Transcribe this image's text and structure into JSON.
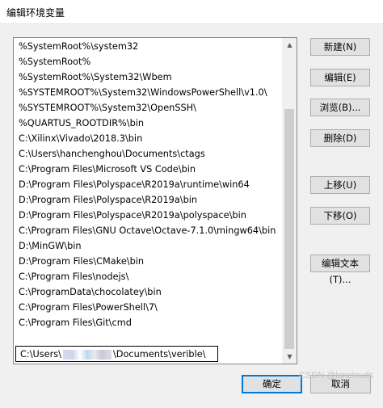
{
  "window": {
    "title": "编辑环境变量"
  },
  "list": {
    "items": [
      "%SystemRoot%\\system32",
      "%SystemRoot%",
      "%SystemRoot%\\System32\\Wbem",
      "%SYSTEMROOT%\\System32\\WindowsPowerShell\\v1.0\\",
      "%SYSTEMROOT%\\System32\\OpenSSH\\",
      "%QUARTUS_ROOTDIR%\\bin",
      "C:\\Xilinx\\Vivado\\2018.3\\bin",
      "C:\\Users\\hanchenghou\\Documents\\ctags",
      "C:\\Program Files\\Microsoft VS Code\\bin",
      "D:\\Program Files\\Polyspace\\R2019a\\runtime\\win64",
      "D:\\Program Files\\Polyspace\\R2019a\\bin",
      "D:\\Program Files\\Polyspace\\R2019a\\polyspace\\bin",
      "C:\\Program Files\\GNU Octave\\Octave-7.1.0\\mingw64\\bin",
      "D:\\MinGW\\bin",
      "D:\\Program Files\\CMake\\bin",
      "C:\\Program Files\\nodejs\\",
      "C:\\ProgramData\\chocolatey\\bin",
      "C:\\Program Files\\PowerShell\\7\\",
      "C:\\Program Files\\Git\\cmd"
    ],
    "editing_prefix": "C:\\Users\\",
    "editing_suffix": "\\Documents\\verible\\"
  },
  "buttons": {
    "new": "新建(N)",
    "edit": "编辑(E)",
    "browse": "浏览(B)...",
    "delete": "删除(D)",
    "move_up": "上移(U)",
    "move_down": "下移(O)",
    "edit_text": "编辑文本(T)...",
    "ok": "确定",
    "cancel": "取消"
  },
  "watermark": "CSDN @lanclouds",
  "colors": {
    "default_button_border": "#0078d7"
  }
}
